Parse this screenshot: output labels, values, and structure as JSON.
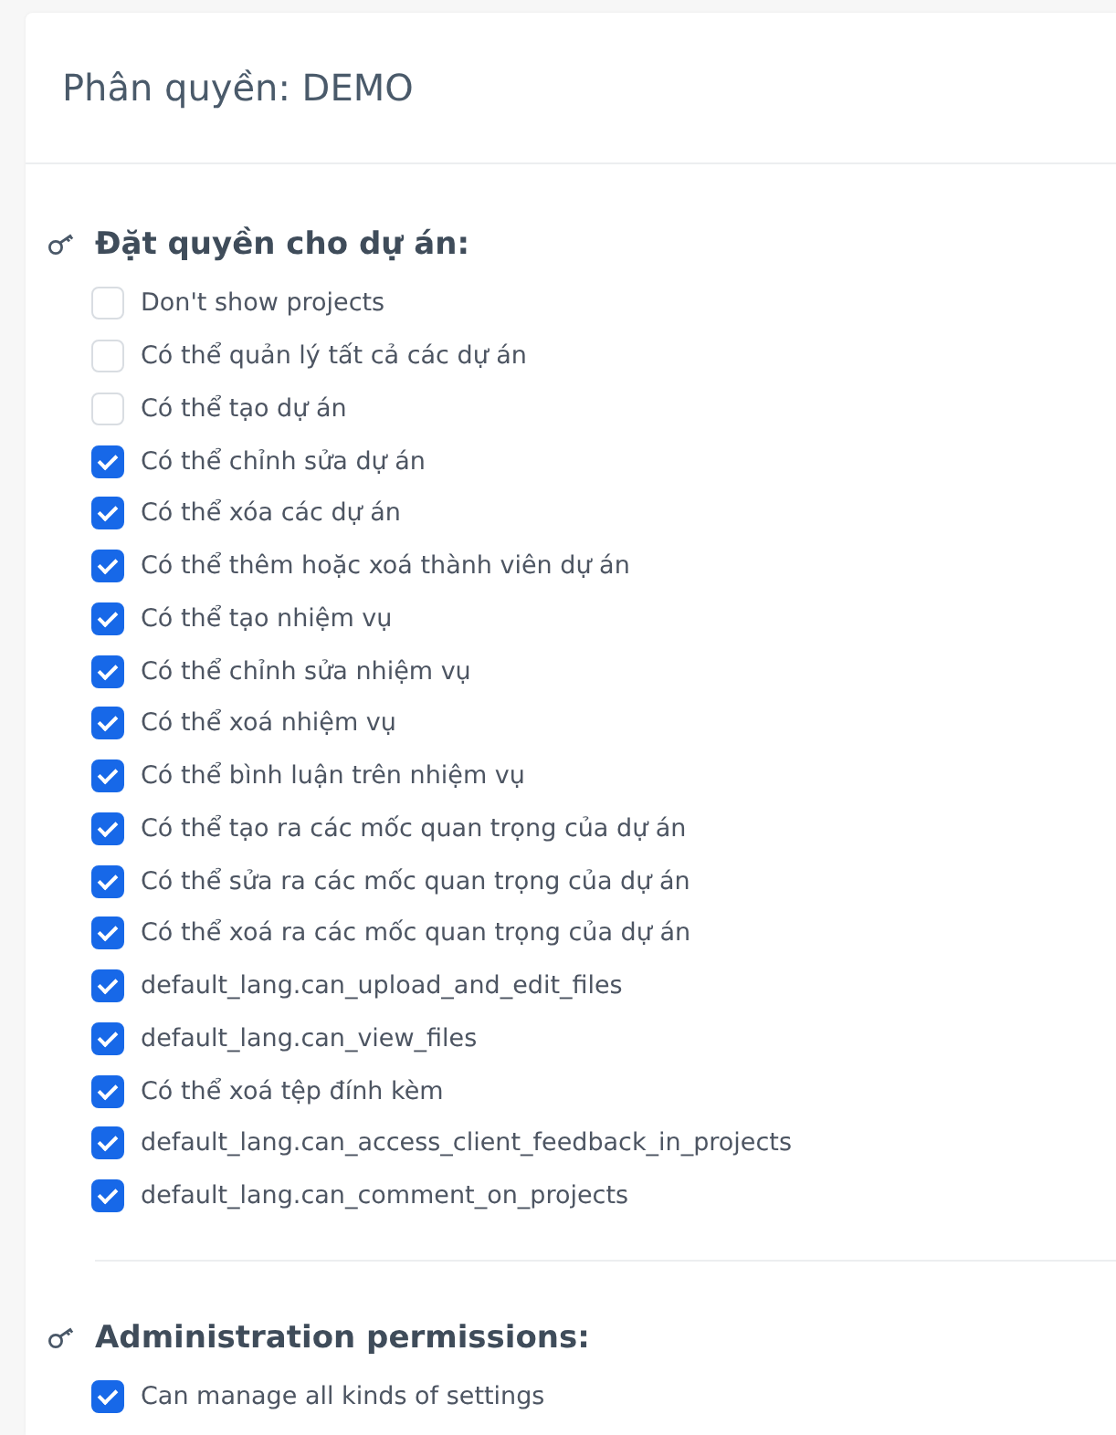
{
  "title": "Phân quyền: DEMO",
  "sections": [
    {
      "heading": "Đặt quyền cho dự án:",
      "permissions": [
        {
          "label": "Don't show projects",
          "checked": false
        },
        {
          "label": "Có thể quản lý tất cả các dự án",
          "checked": false
        },
        {
          "label": "Có thể tạo dự án",
          "checked": false
        },
        {
          "label": "Có thể chỉnh sửa dự án",
          "checked": true
        },
        {
          "label": "Có thể xóa các dự án",
          "checked": true
        },
        {
          "label": "Có thể thêm hoặc xoá thành viên dự án",
          "checked": true
        },
        {
          "label": "Có thể tạo nhiệm vụ",
          "checked": true
        },
        {
          "label": "Có thể chỉnh sửa nhiệm vụ",
          "checked": true
        },
        {
          "label": "Có thể xoá nhiệm vụ",
          "checked": true
        },
        {
          "label": "Có thể bình luận trên nhiệm vụ",
          "checked": true
        },
        {
          "label": "Có thể tạo ra các mốc quan trọng của dự án",
          "checked": true
        },
        {
          "label": "Có thể sửa ra các mốc quan trọng của dự án",
          "checked": true
        },
        {
          "label": "Có thể xoá ra các mốc quan trọng của dự án",
          "checked": true
        },
        {
          "label": "default_lang.can_upload_and_edit_files",
          "checked": true
        },
        {
          "label": "default_lang.can_view_files",
          "checked": true
        },
        {
          "label": "Có thể xoá tệp đính kèm",
          "checked": true
        },
        {
          "label": "default_lang.can_access_client_feedback_in_projects",
          "checked": true
        },
        {
          "label": "default_lang.can_comment_on_projects",
          "checked": true
        }
      ]
    },
    {
      "heading": "Administration permissions:",
      "permissions": [
        {
          "label": "Can manage all kinds of settings",
          "checked": true
        }
      ]
    }
  ]
}
